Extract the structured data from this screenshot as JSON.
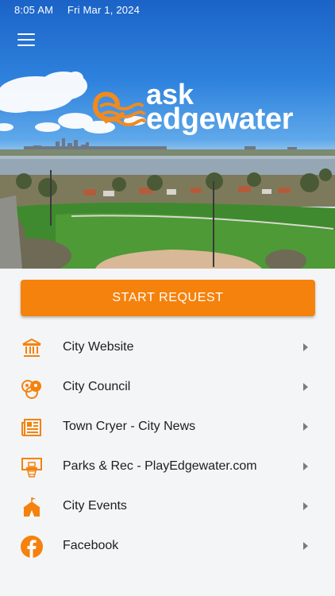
{
  "status_bar": {
    "time": "8:05 AM",
    "date": "Fri Mar 1, 2024"
  },
  "logo": {
    "line1": "ask",
    "line2": "edgewater"
  },
  "start_request": {
    "label": "START REQUEST"
  },
  "menu": [
    {
      "label": "City Website",
      "icon": "city-hall-icon"
    },
    {
      "label": "City Council",
      "icon": "council-people-icon"
    },
    {
      "label": "Town Cryer - City News",
      "icon": "newspaper-icon"
    },
    {
      "label": "Parks & Rec - PlayEdgewater.com",
      "icon": "basketball-hoop-icon"
    },
    {
      "label": "City Events",
      "icon": "circus-tent-icon"
    },
    {
      "label": "Facebook",
      "icon": "facebook-icon"
    }
  ],
  "colors": {
    "accent": "#f5820c",
    "background": "#f4f5f7"
  }
}
